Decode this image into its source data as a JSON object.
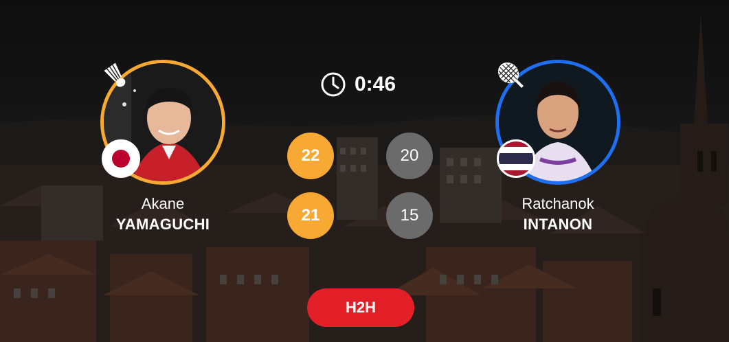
{
  "match": {
    "duration": "0:46",
    "h2h_label": "H2H"
  },
  "player1": {
    "first_name": "Akane",
    "last_name": "YAMAGUCHI",
    "country": "Japan",
    "ring_color": "#f7a933",
    "serve_icon": "shuttlecock-icon",
    "scores": [
      "22",
      "21"
    ]
  },
  "player2": {
    "first_name": "Ratchanok",
    "last_name": "INTANON",
    "country": "Thailand",
    "ring_color": "#1e6ff2",
    "serve_icon": "racket-icon",
    "scores": [
      "20",
      "15"
    ]
  },
  "colors": {
    "winner_score": "#f7a933",
    "loser_score": "#6b6b6b",
    "h2h_button": "#e32028"
  }
}
